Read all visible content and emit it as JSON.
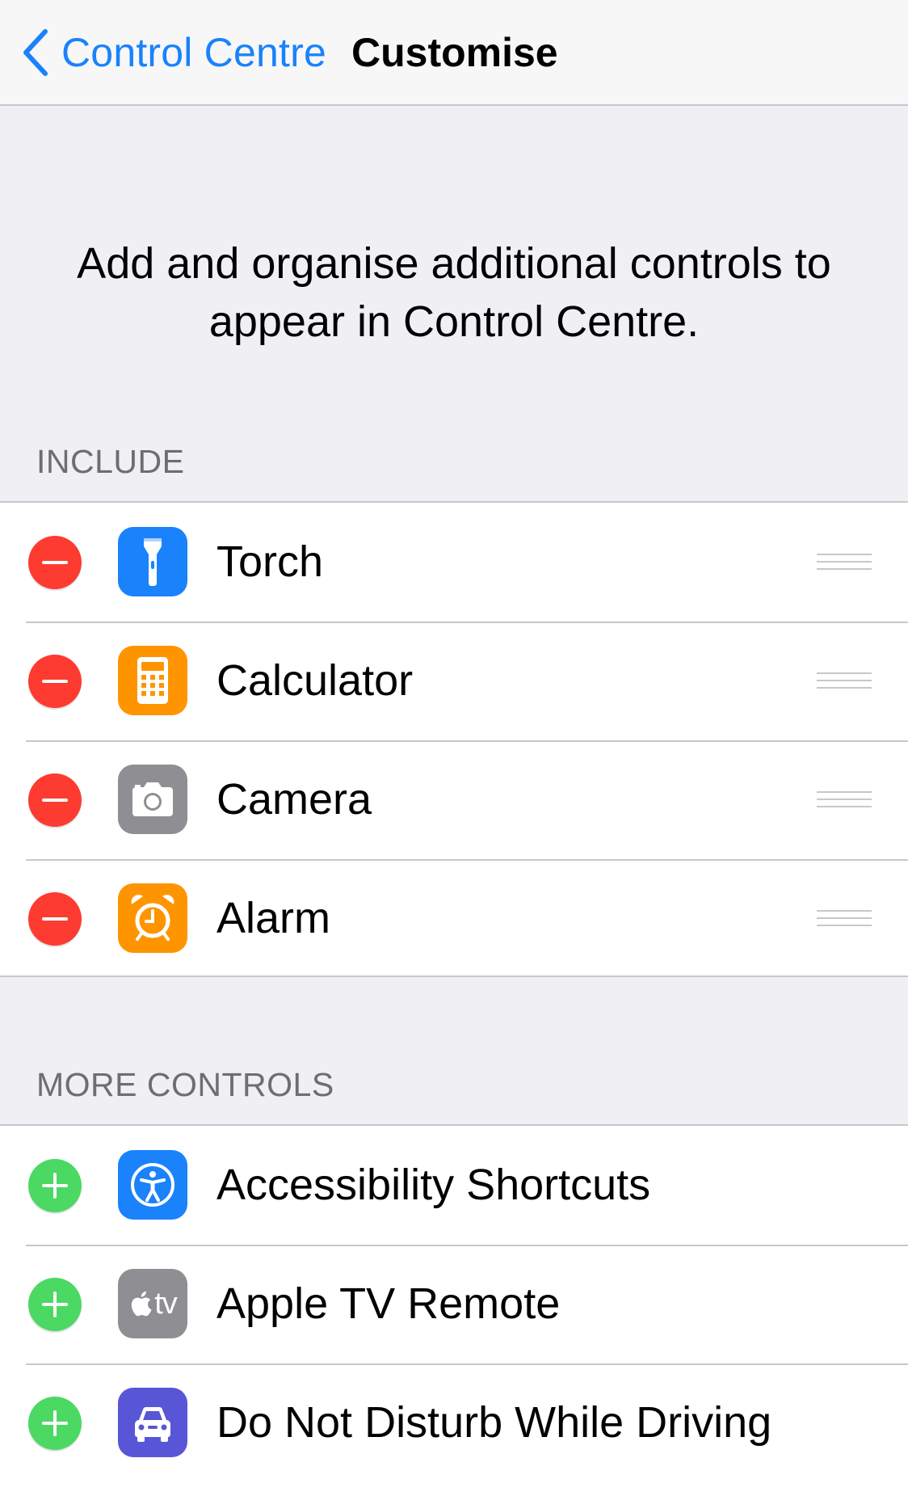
{
  "nav": {
    "back_label": "Control Centre",
    "title": "Customise"
  },
  "description": "Add and organise additional controls to appear in Control Centre.",
  "include": {
    "header": "INCLUDE",
    "items": [
      {
        "label": "Torch",
        "icon": "torch-icon",
        "color": "#1a82fb"
      },
      {
        "label": "Calculator",
        "icon": "calculator-icon",
        "color": "#fe9500"
      },
      {
        "label": "Camera",
        "icon": "camera-icon",
        "color": "#8e8e93"
      },
      {
        "label": "Alarm",
        "icon": "alarm-clock-icon",
        "color": "#fe9500"
      }
    ]
  },
  "more": {
    "header": "MORE CONTROLS",
    "items": [
      {
        "label": "Accessibility Shortcuts",
        "icon": "accessibility-icon",
        "color": "#1a82fb"
      },
      {
        "label": "Apple TV Remote",
        "icon": "apple-tv-icon",
        "color": "#8e8e93",
        "icon_text": "tv"
      },
      {
        "label": "Do Not Disturb While Driving",
        "icon": "car-icon",
        "color": "#5856d6"
      }
    ]
  },
  "colors": {
    "accent": "#1a82fb",
    "remove": "#fd3b30",
    "add": "#4bd863",
    "background": "#efeff4"
  }
}
